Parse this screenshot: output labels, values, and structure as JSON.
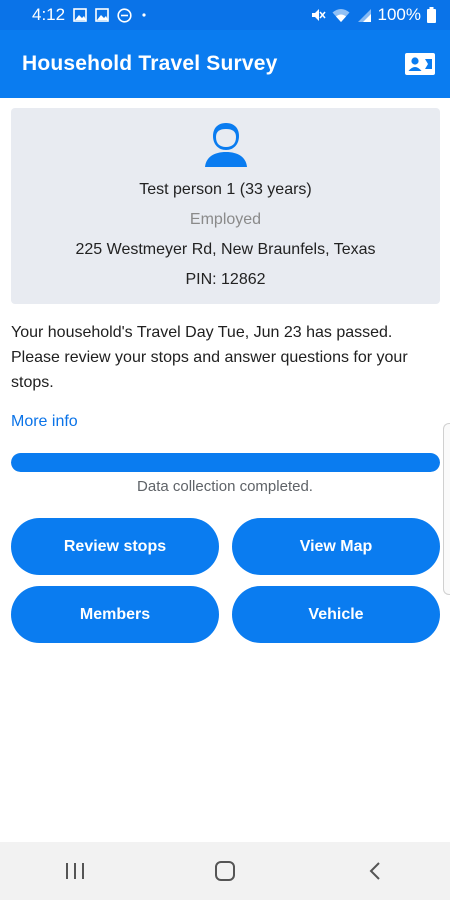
{
  "status_bar": {
    "time": "4:12",
    "battery": "100%",
    "icons": [
      "image-icon",
      "image-icon",
      "do-not-disturb-icon",
      "dot-icon",
      "mute-icon",
      "wifi-icon",
      "signal-icon",
      "battery-icon"
    ]
  },
  "app_bar": {
    "title": "Household Travel Survey",
    "action_icon": "contact-card-icon"
  },
  "person": {
    "avatar_icon": "person-icon",
    "name": "Test person 1 (33 years)",
    "employment": "Employed",
    "address": "225 Westmeyer Rd, New Braunfels, Texas",
    "pin": "PIN: 12862"
  },
  "message": {
    "text": "Your household's Travel Day Tue, Jun 23 has passed. Please review your stops and answer questions for your stops.",
    "more_info": "More info"
  },
  "progress": {
    "fraction": 1.0,
    "label": "Data collection completed."
  },
  "buttons": {
    "review_stops": "Review stops",
    "view_map": "View Map",
    "members": "Members",
    "vehicle": "Vehicle"
  },
  "nav_bar": {
    "icons": [
      "recent-apps-icon",
      "home-icon",
      "back-icon"
    ]
  },
  "colors": {
    "primary": "#0a7cf0",
    "status_bar": "#0a73e8",
    "card_bg": "#e8ebf1",
    "link": "#0a73e8"
  }
}
